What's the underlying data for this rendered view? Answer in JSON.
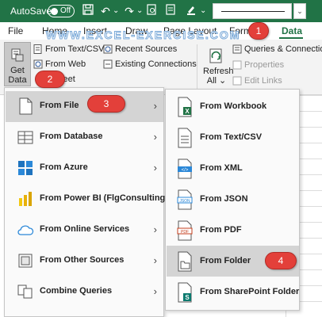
{
  "titlebar": {
    "autosave_label": "AutoSave",
    "toggle_state": "Off",
    "accent_color": "#217346"
  },
  "tabs": [
    {
      "label": "File"
    },
    {
      "label": "Home"
    },
    {
      "label": "Insert"
    },
    {
      "label": "Draw"
    },
    {
      "label": "Page Layout"
    },
    {
      "label": "Form"
    },
    {
      "label": "Data",
      "active": true
    }
  ],
  "watermark": "WWW.EXCEL-EXERCISE.COM",
  "ribbon": {
    "get_data_label": "Get Data",
    "get_data_line1": "Get",
    "get_data_line2": "Data ⌄",
    "buttons": [
      {
        "label": "From Text/CSV"
      },
      {
        "label": "Recent Sources"
      },
      {
        "label": "From Web"
      },
      {
        "label": "Existing Connections"
      },
      {
        "label": "Sheet"
      }
    ],
    "refresh_all_line1": "Refresh",
    "refresh_all_line2": "All ⌄",
    "queries_connections": "Queries & Connections",
    "properties": "Properties",
    "edit_links": "Edit Links"
  },
  "get_data_menu": {
    "items": [
      {
        "label": "From File",
        "icon": "file-icon",
        "selected": true
      },
      {
        "label": "From Database",
        "icon": "database-icon"
      },
      {
        "label": "From Azure",
        "icon": "azure-icon"
      },
      {
        "label": "From Power BI (FlgConsulting)",
        "icon": "power-bi-icon"
      },
      {
        "label": "From Online Services",
        "icon": "cloud-icon"
      },
      {
        "label": "From Other Sources",
        "icon": "other-sources-icon"
      },
      {
        "label": "Combine Queries",
        "icon": "combine-icon"
      }
    ]
  },
  "from_file_submenu": {
    "items": [
      {
        "label": "From Workbook",
        "icon": "excel-workbook-icon"
      },
      {
        "label": "From Text/CSV",
        "icon": "text-file-icon"
      },
      {
        "label": "From XML",
        "icon": "xml-file-icon"
      },
      {
        "label": "From JSON",
        "icon": "json-file-icon"
      },
      {
        "label": "From PDF",
        "icon": "pdf-file-icon"
      },
      {
        "label": "From Folder",
        "icon": "folder-icon",
        "selected": true
      },
      {
        "label": "From SharePoint Folder",
        "icon": "sharepoint-folder-icon"
      }
    ]
  },
  "callouts": [
    "1",
    "2",
    "3",
    "4"
  ]
}
